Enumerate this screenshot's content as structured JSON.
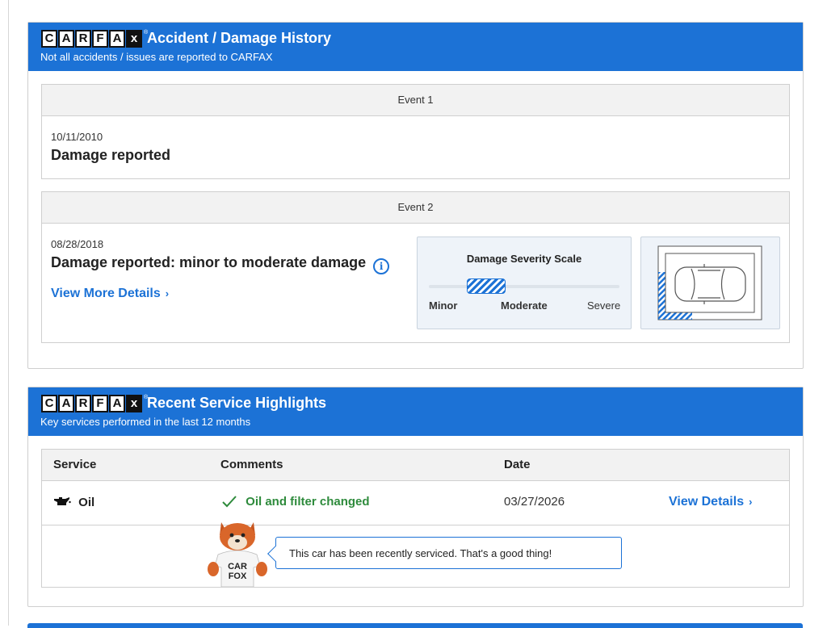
{
  "top_fragment": "[partial text cut off at top edge]",
  "accident_card": {
    "title": "Accident / Damage History",
    "subtitle": "Not all accidents / issues are reported to CARFAX",
    "events": [
      {
        "label": "Event 1",
        "date": "10/11/2010",
        "title": "Damage reported"
      },
      {
        "label": "Event 2",
        "date": "08/28/2018",
        "title": "Damage reported: minor to moderate damage",
        "link": "View More Details"
      }
    ],
    "severity": {
      "title": "Damage Severity Scale",
      "labels": [
        "Minor",
        "Moderate",
        "Severe"
      ],
      "level": "minor to moderate"
    }
  },
  "logo": {
    "letters": [
      "C",
      "A",
      "R",
      "F",
      "A",
      "x"
    ],
    "mark": "®"
  },
  "service_card": {
    "title": "Recent Service Highlights",
    "subtitle": "Key services performed in the last 12 months",
    "columns": [
      "Service",
      "Comments",
      "Date"
    ],
    "rows": [
      {
        "service": "Oil",
        "comment": "Oil and filter changed",
        "date": "03/27/2026",
        "link": "View Details"
      }
    ],
    "mascot_text": [
      "CAR",
      "FOX"
    ],
    "bubble": "This car has been recently serviced. That's a good thing!"
  },
  "colors": {
    "brand_blue": "#1c72d6",
    "ok_green": "#2e8b3c"
  }
}
